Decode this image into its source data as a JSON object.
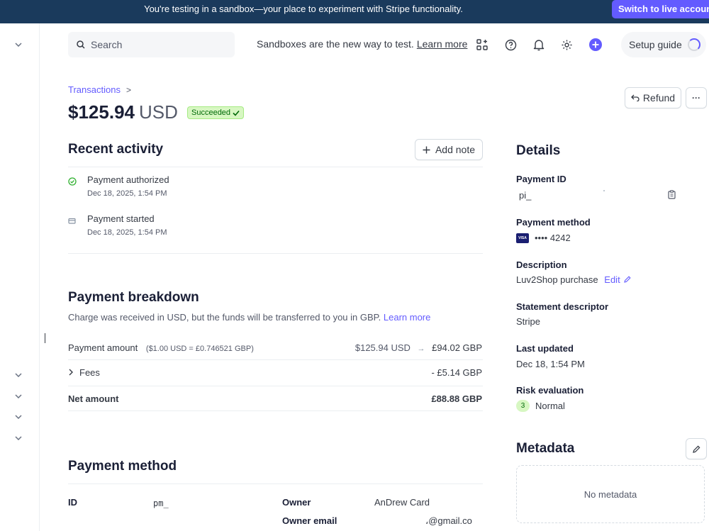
{
  "banner": {
    "text": "You're testing in a sandbox—your place to experiment with Stripe functionality.",
    "live_button": "Switch to live account"
  },
  "topbar": {
    "search_placeholder": "Search",
    "sandbox_msg": "Sandboxes are the new way to test.",
    "learn_more": "Learn more",
    "setup_guide": "Setup guide"
  },
  "header": {
    "breadcrumb": "Transactions",
    "breadcrumb_sep": ">",
    "amount": "$125.94",
    "currency": "USD",
    "status": "Succeeded",
    "refund": "Refund",
    "more": "···"
  },
  "activity": {
    "title": "Recent activity",
    "add_note": "Add note",
    "items": [
      {
        "title": "Payment authorized",
        "time": "Dec 18, 2025, 1:54 PM"
      },
      {
        "title": "Payment started",
        "time": "Dec 18, 2025, 1:54 PM"
      }
    ]
  },
  "breakdown": {
    "title": "Payment breakdown",
    "subtitle": "Charge was received in USD, but the funds will be transferred to you in GBP.",
    "learn_more": "Learn more",
    "rows": [
      {
        "label": "Payment amount",
        "note": "($1.00 USD = £0.746521 GBP)",
        "from": "$125.94 USD",
        "arrow": "→",
        "value": "£94.02 GBP"
      },
      {
        "label": "Fees",
        "value": "- £5.14 GBP"
      },
      {
        "label": "Net amount",
        "value": "£88.88 GBP"
      }
    ]
  },
  "payment_method": {
    "title": "Payment method",
    "id_label": "ID",
    "id_value": "pm_",
    "owner_label": "Owner",
    "owner_value": "AnDrew Card",
    "email_label": "Owner email",
    "email_value": "،@gmail.co"
  },
  "details": {
    "title": "Details",
    "payment_id_label": "Payment ID",
    "payment_id": "pi_",
    "payment_method_label": "Payment method",
    "card_brand": "VISA",
    "card_last4": "•••• 4242",
    "description_label": "Description",
    "description": "Luv2Shop purchase",
    "edit": "Edit",
    "statement_label": "Statement descriptor",
    "statement": "Stripe",
    "updated_label": "Last updated",
    "updated": "Dec 18, 1:54 PM",
    "risk_label": "Risk evaluation",
    "risk_score": "3",
    "risk_value": "Normal"
  },
  "metadata": {
    "title": "Metadata",
    "empty": "No metadata"
  },
  "colors": {
    "accent": "#635bff",
    "banner": "#1a3a5c",
    "success": "#006908"
  }
}
